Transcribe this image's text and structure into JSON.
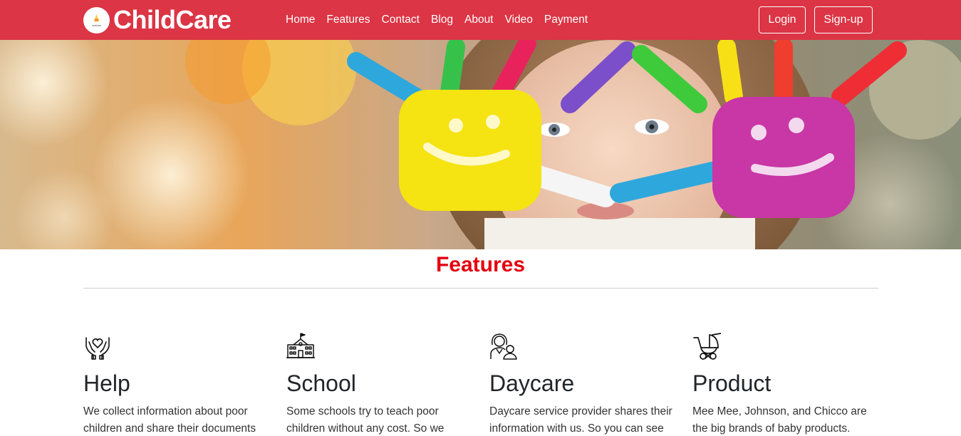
{
  "brand": {
    "name": "ChildCare",
    "logo_text": "mattam",
    "logo_icon": "cone-logo-icon"
  },
  "nav": {
    "links": [
      "Home",
      "Features",
      "Contact",
      "Blog",
      "About",
      "Video",
      "Payment"
    ],
    "login_label": "Login",
    "signup_label": "Sign-up"
  },
  "hero": {
    "image": "child-with-painted-smiley-hands"
  },
  "features": {
    "title": "Features",
    "cards": [
      {
        "icon": "hands-heart-icon",
        "title": "Help",
        "text": "We collect information about poor children and share their documents"
      },
      {
        "icon": "school-building-icon",
        "title": "School",
        "text": "Some schools try to teach poor children without any cost. So we"
      },
      {
        "icon": "parent-child-icon",
        "title": "Daycare",
        "text": "Daycare service provider shares their information with us. So you can see"
      },
      {
        "icon": "baby-stroller-icon",
        "title": "Product",
        "text": "Mee Mee, Johnson, and Chicco are the big brands of baby products."
      }
    ]
  },
  "colors": {
    "primary": "#dc3545",
    "heading_red": "#e3000f"
  }
}
